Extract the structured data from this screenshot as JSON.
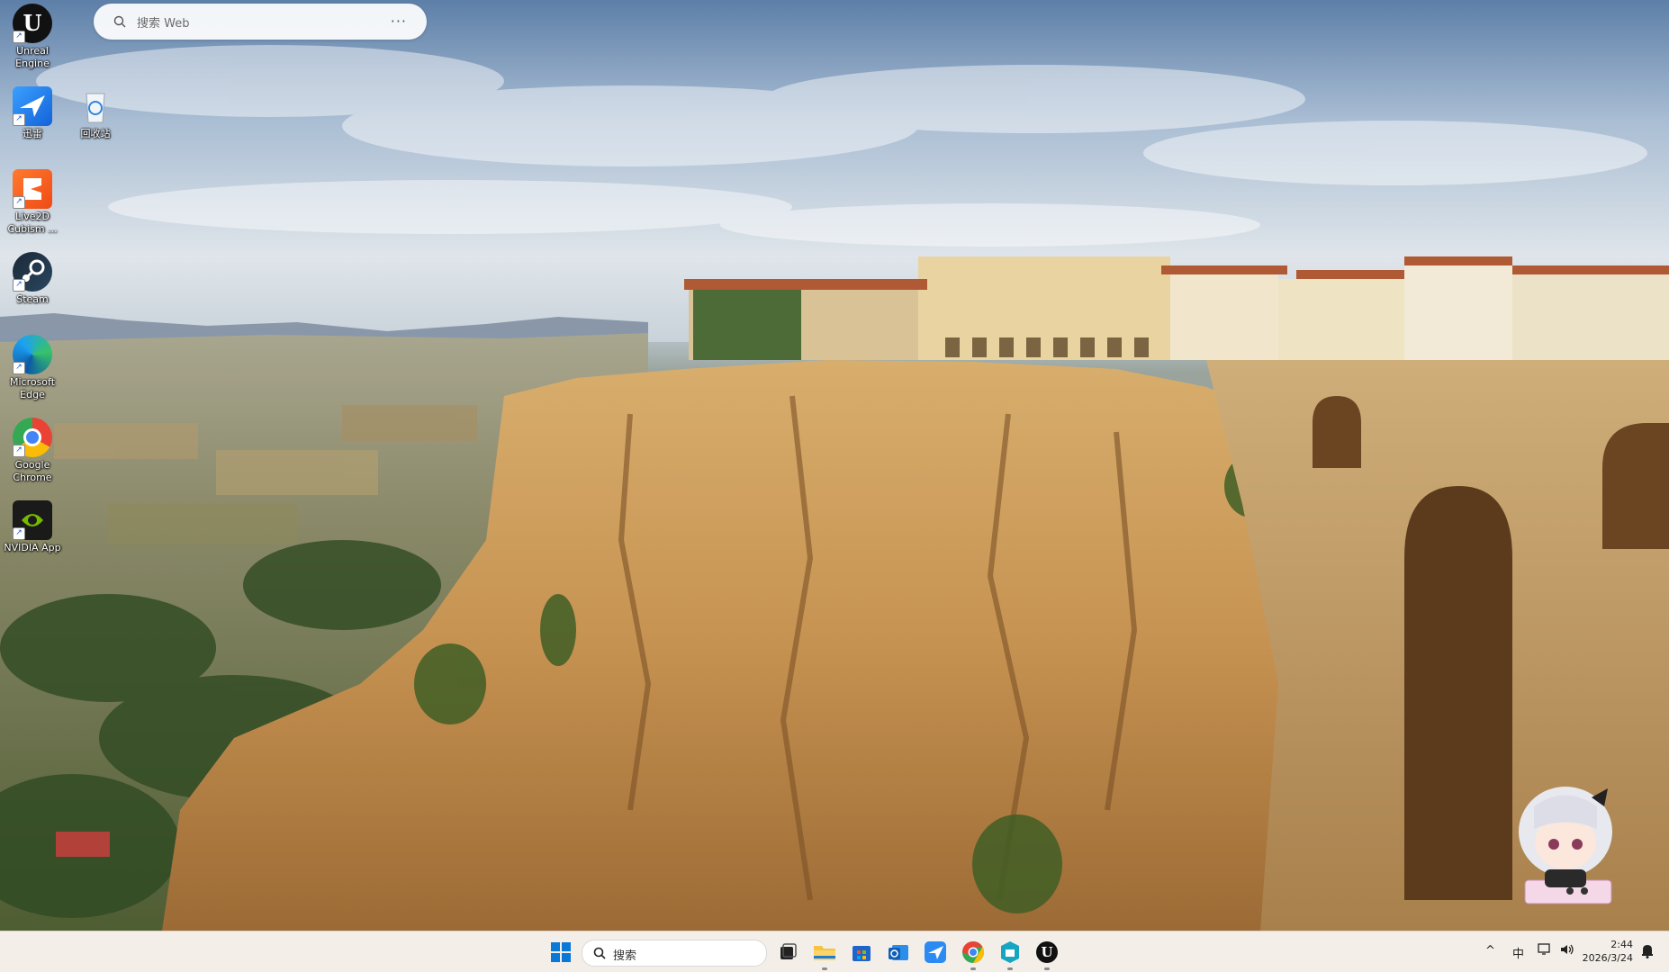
{
  "web_search": {
    "placeholder": "搜索 Web",
    "more": "···"
  },
  "desktop_icons": [
    {
      "label": "Unreal Engine",
      "icon": "unreal-engine-icon"
    },
    {
      "label": "迅雷",
      "icon": "xunlei-icon"
    },
    {
      "label": "回收站",
      "icon": "recycle-bin-icon"
    },
    {
      "label": "Live2D Cubism ...",
      "icon": "live2d-icon"
    },
    {
      "label": "Steam",
      "icon": "steam-icon"
    },
    {
      "label": "Microsoft Edge",
      "icon": "edge-icon"
    },
    {
      "label": "Google Chrome",
      "icon": "chrome-icon"
    },
    {
      "label": "NVIDIA App",
      "icon": "nvidia-icon"
    }
  ],
  "taskbar": {
    "search_label": "搜索",
    "apps": [
      "start-icon",
      "task-view-icon",
      "file-explorer-icon",
      "microsoft-store-icon",
      "outlook-icon",
      "xunlei-icon",
      "chrome-icon",
      "vpn-app-icon",
      "unreal-engine-icon"
    ],
    "tray": {
      "chevron": "^",
      "ime": "中",
      "time": "2:44",
      "date": "2026/3/24"
    }
  },
  "colors": {
    "taskbar_bg": "#f3efe8",
    "windows_blue": "#0a78d7"
  }
}
